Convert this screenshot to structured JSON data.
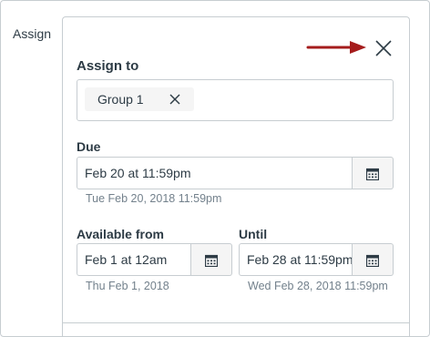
{
  "assign_label": "Assign",
  "section": {
    "title": "Assign to",
    "token": {
      "label": "Group 1",
      "remove_icon": "close-icon"
    }
  },
  "due": {
    "label": "Due",
    "value": "Feb 20 at 11:59pm",
    "hint": "Tue Feb 20, 2018 11:59pm"
  },
  "available_from": {
    "label": "Available from",
    "value": "Feb 1 at 12am",
    "hint": "Thu Feb 1, 2018"
  },
  "until": {
    "label": "Until",
    "value": "Feb 28 at 11:59pm",
    "hint": "Wed Feb 28, 2018 11:59pm"
  },
  "icons": {
    "close": "close-icon",
    "calendar": "calendar-icon",
    "annotation_arrow": "arrow-right-icon"
  },
  "colors": {
    "annotation_arrow": "#a51c1c",
    "border": "#c7cdd1",
    "text": "#2d3b45",
    "hint": "#73818c"
  }
}
